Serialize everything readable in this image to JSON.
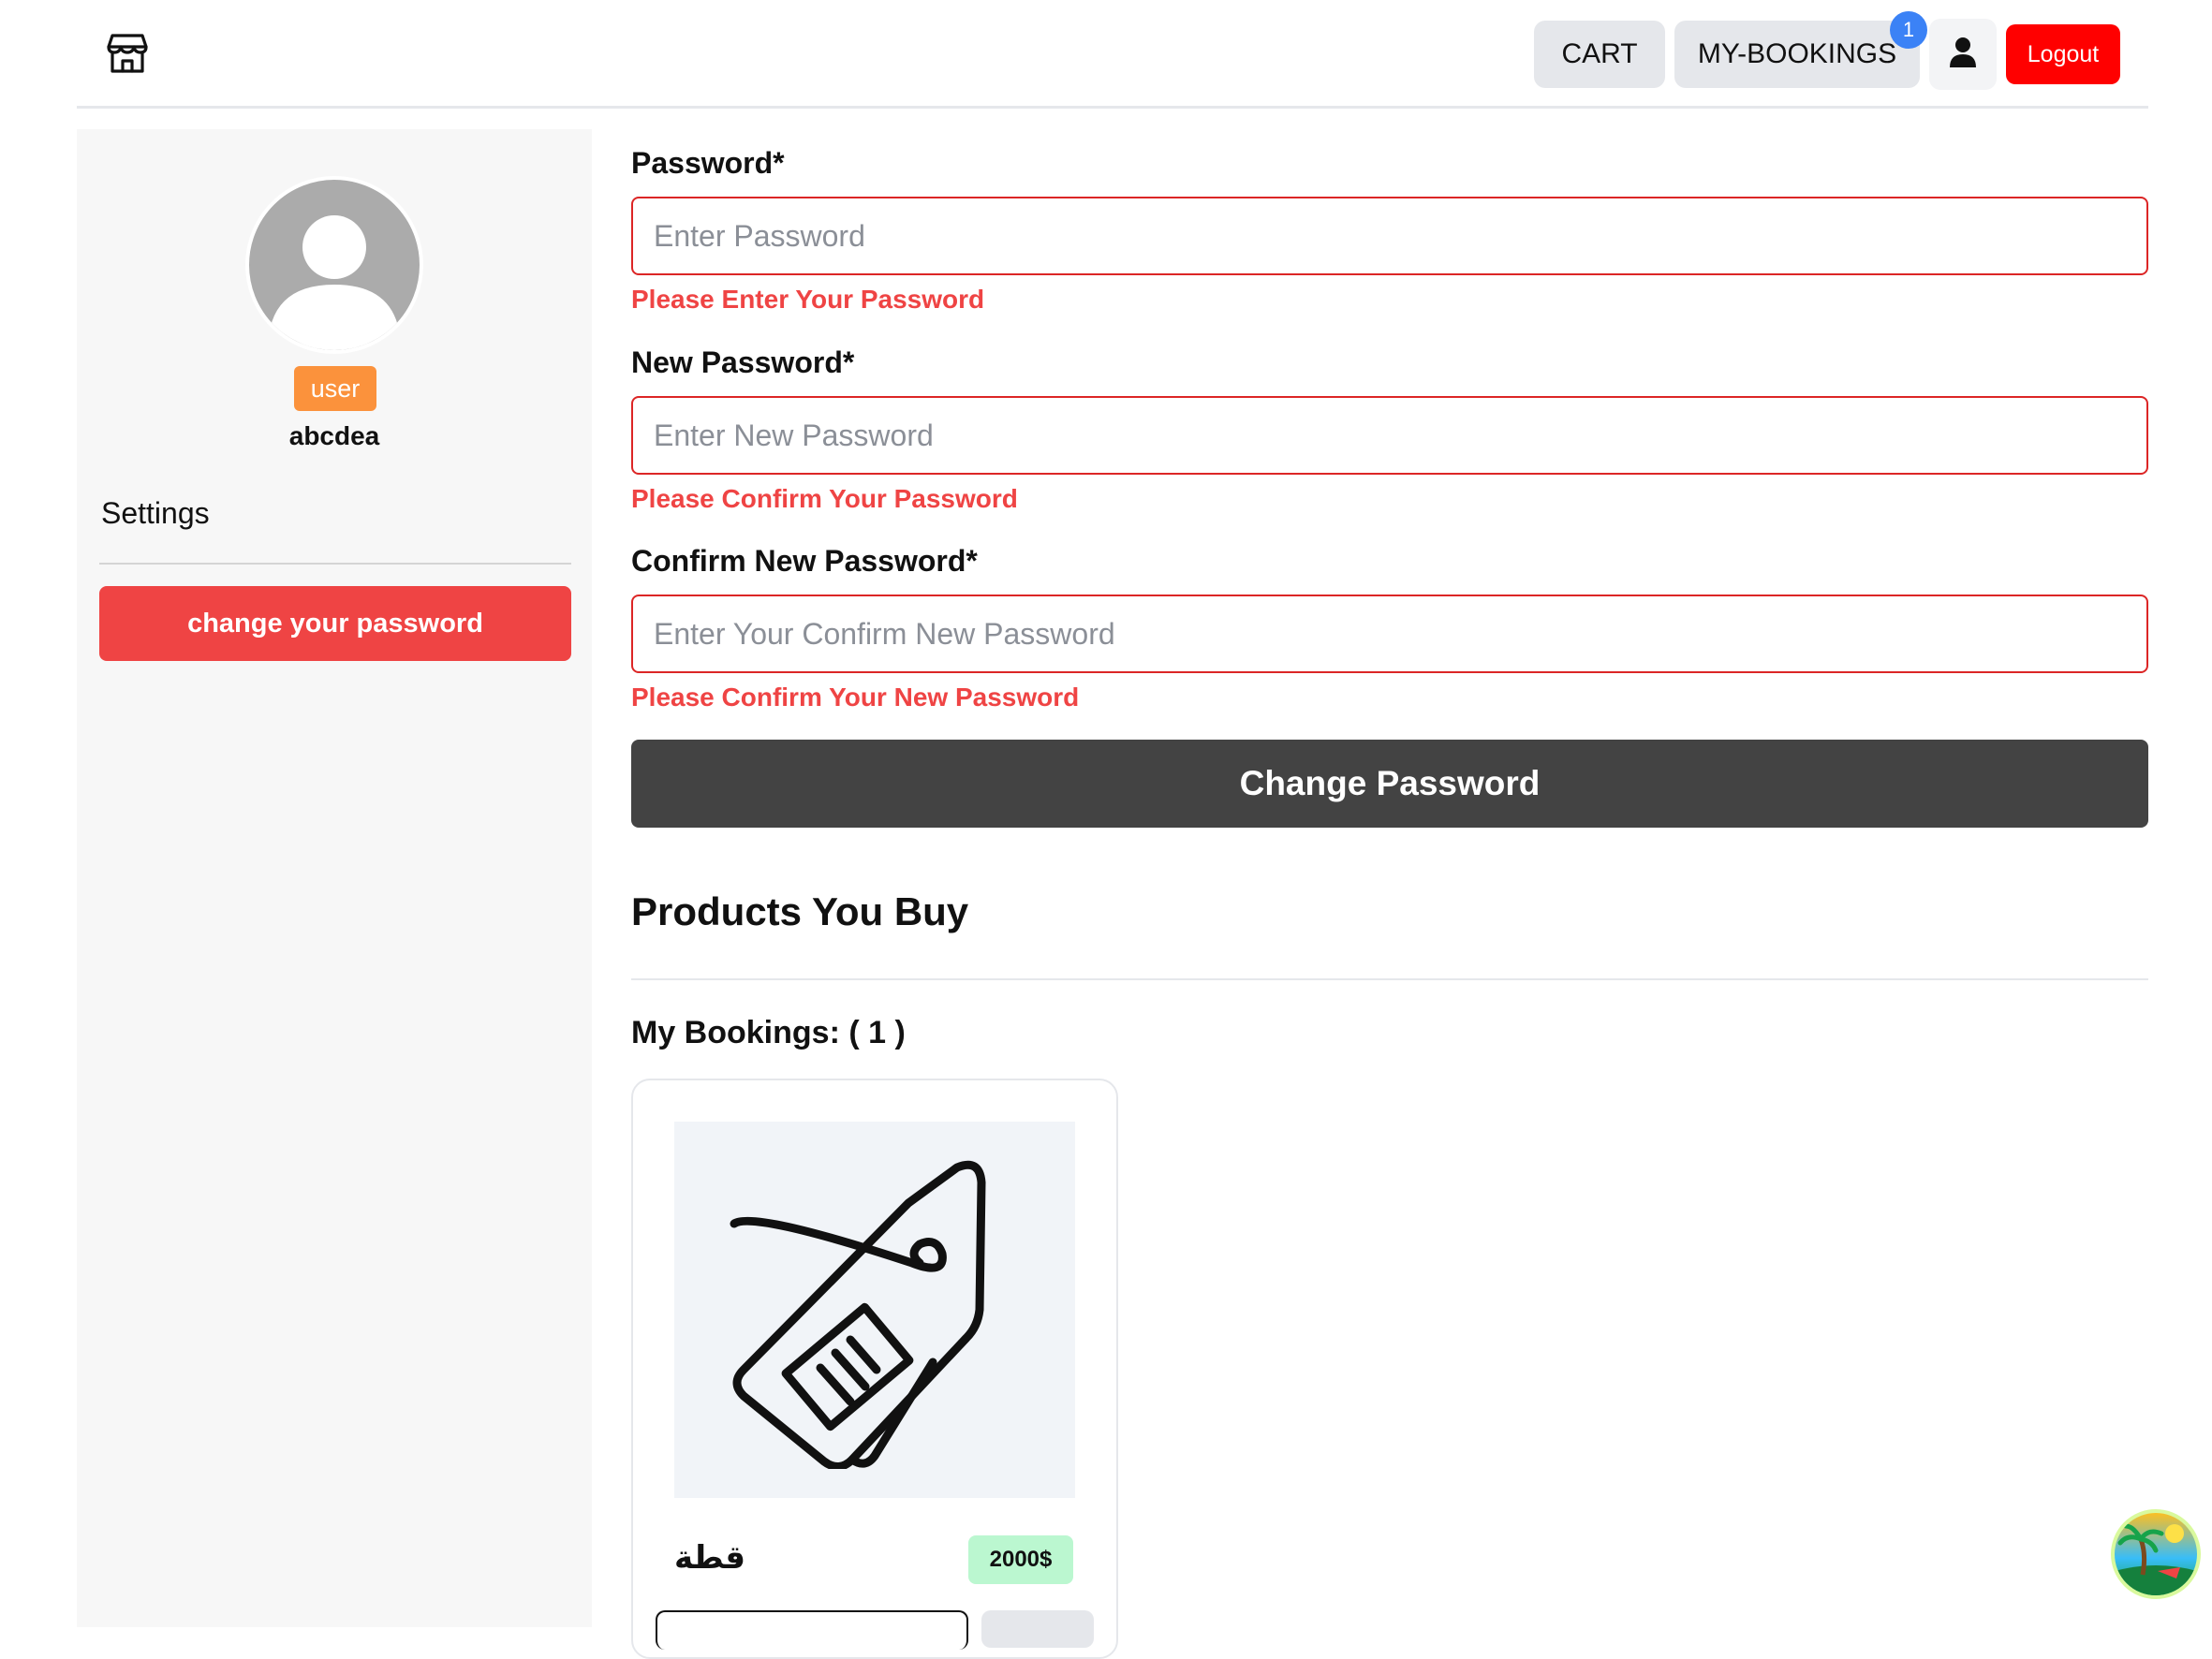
{
  "header": {
    "nav": {
      "cart_label": "CART",
      "bookings_label": "MY-BOOKINGS",
      "bookings_count": "1",
      "logout_label": "Logout"
    },
    "icons": {
      "logo": "store-icon",
      "user": "user-icon"
    }
  },
  "sidebar": {
    "role": "user",
    "username": "abcdea",
    "settings_label": "Settings",
    "change_password_label": "change your password"
  },
  "form": {
    "password": {
      "label": "Password*",
      "placeholder": "Enter Password",
      "value": "",
      "error": "Please Enter Your Password"
    },
    "new_password": {
      "label": "New Password*",
      "placeholder": "Enter New Password",
      "value": "",
      "error": "Please Confirm Your Password"
    },
    "confirm_password": {
      "label": "Confirm New Password*",
      "placeholder": "Enter Your Confirm New Password",
      "value": "",
      "error": "Please Confirm Your New Password"
    },
    "submit_label": "Change Password"
  },
  "products": {
    "title": "Products You Buy",
    "bookings_title": "My Bookings: ( 1 )",
    "items": [
      {
        "name": "قطة",
        "price": "2000$",
        "image_icon": "price-tag-icon"
      }
    ]
  },
  "colors": {
    "error": "#ef4444",
    "logout": "#ff0000",
    "badge": "#3b82f6",
    "role_badge": "#fb923c",
    "submit": "#434343",
    "price": "#bbf7d0"
  }
}
